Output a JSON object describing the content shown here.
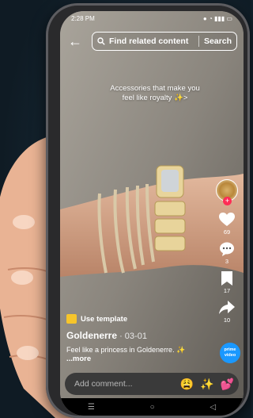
{
  "status_bar": {
    "time": "2:28 PM",
    "icons": [
      "signal-icon",
      "wifi-icon",
      "battery-icon"
    ]
  },
  "header": {
    "back_icon": "back-arrow-icon",
    "search_placeholder": "Find related content",
    "search_button": "Search"
  },
  "video": {
    "overlay_caption": "Accessories that make you feel like royalty ✨>",
    "subject": "bracelets and smartwatch on wrist"
  },
  "rail": {
    "likes": "69",
    "comments": "3",
    "saves": "17",
    "shares": "10",
    "prime_badge": "prime video"
  },
  "bottom": {
    "template_label": "Use template",
    "author": "Goldenerre",
    "date": " · 03-01",
    "description": "Feel like a princess in Goldenerre. ✨",
    "more": "...more"
  },
  "comment_bar": {
    "placeholder": "Add comment...",
    "emojis": [
      "😩",
      "✨",
      "💕"
    ]
  },
  "colors": {
    "accent_red": "#fe2c55",
    "template_yellow": "#f7c52b",
    "prime_blue": "#1a98ff"
  }
}
